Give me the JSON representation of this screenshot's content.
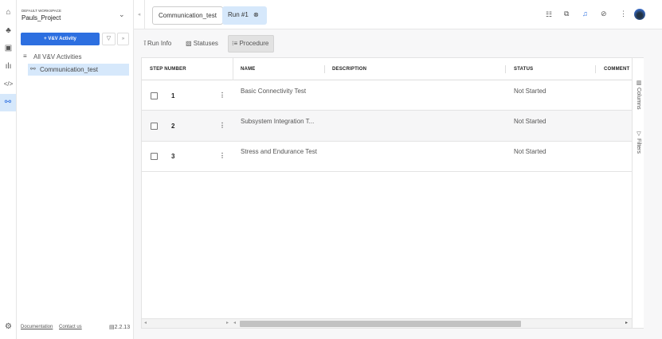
{
  "workspace": {
    "label": "DEFAULT WORKSPACE",
    "name": "Pauls_Project"
  },
  "sidebar": {
    "add_button": "+ V&V Activity",
    "all_label": "All V&V Activities",
    "items": [
      {
        "label": "Communication_test"
      }
    ],
    "footer": {
      "documentation": "Documentation",
      "contact": "Contact us",
      "version": "2.2.13"
    }
  },
  "rail": [
    "home-icon",
    "hierarchy-icon",
    "clipboard-icon",
    "analytics-icon",
    "code-icon",
    "link-icon",
    "settings-icon"
  ],
  "tabs": [
    {
      "label": "Communication_test"
    },
    {
      "label": "Run #1"
    }
  ],
  "subtabs": [
    {
      "label": "Run Info"
    },
    {
      "label": "Statuses"
    },
    {
      "label": "Procedure"
    }
  ],
  "table": {
    "columns": [
      "STEP NUMBER",
      "NAME",
      "DESCRIPTION",
      "STATUS",
      "COMMENT"
    ],
    "rows": [
      {
        "step": "1",
        "name": "Basic Connectivity Test",
        "status": "Not Started"
      },
      {
        "step": "2",
        "name": "Subsystem Integration T...",
        "status": "Not Started"
      },
      {
        "step": "3",
        "name": "Stress and Endurance Test",
        "status": "Not Started"
      }
    ]
  },
  "side_panel": {
    "columns": "Columns",
    "filters": "Filters"
  },
  "colors": {
    "accent": "#2d6fe0",
    "selected": "#d6e8fb"
  }
}
